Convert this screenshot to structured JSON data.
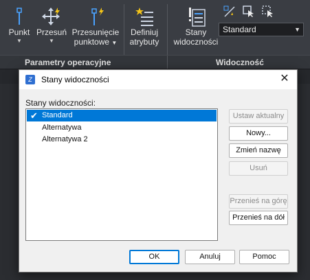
{
  "ribbon": {
    "punkt": "Punkt",
    "przesun": "Przesuń",
    "przesuniecie_line1": "Przesunięcie",
    "przesuniecie_line2": "punktowe",
    "definiuj_line1": "Definiuj",
    "definiuj_line2": "atrybuty",
    "stany_line1": "Stany",
    "stany_line2": "widoczności",
    "combo_value": "Standard",
    "group_params": "Parametry operacyjne",
    "group_visibility": "Widoczność"
  },
  "dialog": {
    "title": "Stany widoczności",
    "list_label": "Stany widoczności:",
    "items": [
      "Standard",
      "Alternatywa",
      "Alternatywa 2"
    ],
    "buttons": {
      "set_current": "Ustaw aktualny",
      "new": "Nowy...",
      "rename": "Zmień nazwę",
      "delete": "Usuń",
      "move_up": "Przenieś na górę",
      "move_down": "Przenieś na dół",
      "ok": "OK",
      "cancel": "Anuluj",
      "help": "Pomoc"
    }
  },
  "colors": {
    "selection": "#0078d7",
    "ribbon_bg": "#3a3d43",
    "icon_blue": "#4aa3ff",
    "icon_yellow": "#f5c518"
  }
}
